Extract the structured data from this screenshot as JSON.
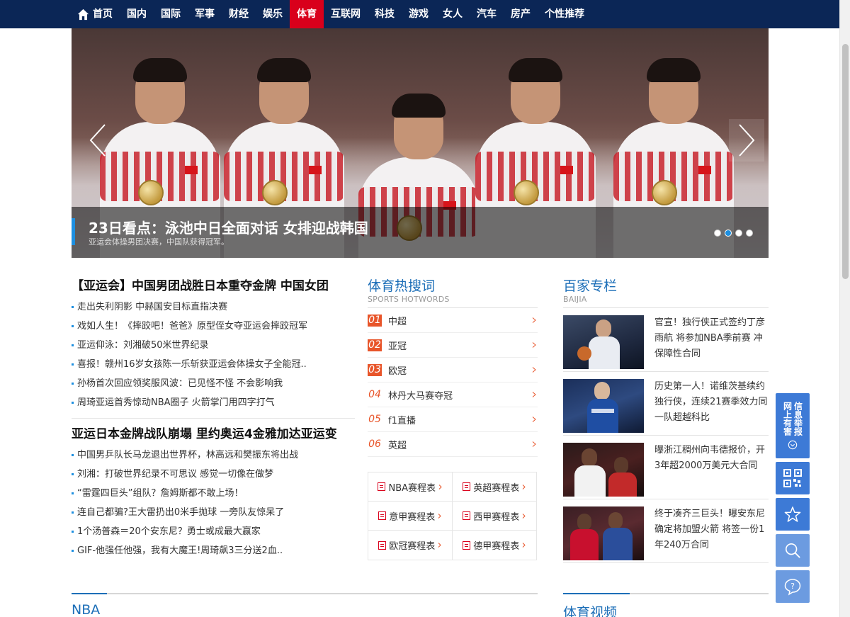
{
  "nav": {
    "items": [
      {
        "label": "首页",
        "active": false
      },
      {
        "label": "国内",
        "active": false
      },
      {
        "label": "国际",
        "active": false
      },
      {
        "label": "军事",
        "active": false
      },
      {
        "label": "财经",
        "active": false
      },
      {
        "label": "娱乐",
        "active": false
      },
      {
        "label": "体育",
        "active": true
      },
      {
        "label": "互联网",
        "active": false
      },
      {
        "label": "科技",
        "active": false
      },
      {
        "label": "游戏",
        "active": false
      },
      {
        "label": "女人",
        "active": false
      },
      {
        "label": "汽车",
        "active": false
      },
      {
        "label": "房产",
        "active": false
      },
      {
        "label": "个性推荐",
        "active": false
      }
    ],
    "colors": {
      "background": "#0b2656",
      "active": "#d9001b"
    }
  },
  "hero": {
    "title": "23日看点：泳池中日全面对话 女排迎战韩国",
    "subtitle": "亚运会体操男团决赛，中国队获得冠军。",
    "slides_total": 4,
    "active_slide": 2,
    "arrows": {
      "left": "chevron-left-icon",
      "right": "chevron-right-icon"
    }
  },
  "news": {
    "group1": {
      "headline": "【亚运会】中国男团战胜日本重夺金牌 中国女团",
      "items": [
        "走出失利阴影 中赫国安目标直指决赛",
        "戏如人生！《摔跤吧！爸爸》原型侄女夺亚运会摔跤冠军",
        "亚运仰泳：刘湘破50米世界纪录",
        "喜报！赣州16岁女孩陈一乐斩获亚运会体操女子全能冠..",
        "孙杨首次回应领奖服风波：已见怪不怪 不会影响我",
        "周琦亚运首秀惊动NBA圈子 火箭掌门用四字打气"
      ]
    },
    "group2": {
      "headline": "亚运日本金牌战队崩塌 里约奥运4金雅加达亚运变",
      "items": [
        "中国男乒队长马龙退出世界杯，林高远和樊振东将出战",
        "刘湘：打破世界纪录不可思议 感觉一切像在做梦",
        "“雷霆四巨头”组队？詹姆斯都不敢上场！",
        "连自己都骗?王大雷扔出0米手抛球 一旁队友惊呆了",
        "1个汤普森＝20个安东尼？勇士或成最大赢家",
        "GIF-他强任他强，我有大魔王!周琦飙3三分送2血.."
      ]
    }
  },
  "hot": {
    "title": "体育热搜词",
    "subtitle": "SPORTS HOTWORDS",
    "items": [
      {
        "num": "01",
        "label": "中超"
      },
      {
        "num": "02",
        "label": "亚冠"
      },
      {
        "num": "03",
        "label": "欧冠"
      },
      {
        "num": "04",
        "label": "林丹大马赛夺冠"
      },
      {
        "num": "05",
        "label": "f1直播"
      },
      {
        "num": "06",
        "label": "英超"
      }
    ],
    "accent": "#e8552a"
  },
  "schedules": [
    "NBA赛程表",
    "英超赛程表",
    "意甲赛程表",
    "西甲赛程表",
    "欧冠赛程表",
    "德甲赛程表"
  ],
  "baijia": {
    "title": "百家专栏",
    "subtitle": "BAIJIA",
    "items": [
      {
        "text": "官宣！独行侠正式签约丁彦雨航 将参加NBA季前赛 冲保障性合同",
        "thumb": "basketball-player-dribbling"
      },
      {
        "text": "历史第一人！诺维茨基续约独行侠，连续21赛季效力同一队超越科比",
        "thumb": "mavericks-player"
      },
      {
        "text": "曝浙江稠州向韦德报价，开3年超2000万美元大合同",
        "thumb": "heat-players"
      },
      {
        "text": "终于凑齐三巨头！曝安东尼确定将加盟火箭 将签一份1年240万合同",
        "thumb": "rockets-players"
      }
    ]
  },
  "tools": {
    "report_label": [
      "网上有害",
      "信息举报"
    ],
    "items": [
      "qr-code-icon",
      "star-icon",
      "search-icon",
      "help-icon"
    ]
  },
  "bottom": {
    "nba": "NBA",
    "video": "体育视频"
  },
  "accent_blue": "#1d6fb8"
}
